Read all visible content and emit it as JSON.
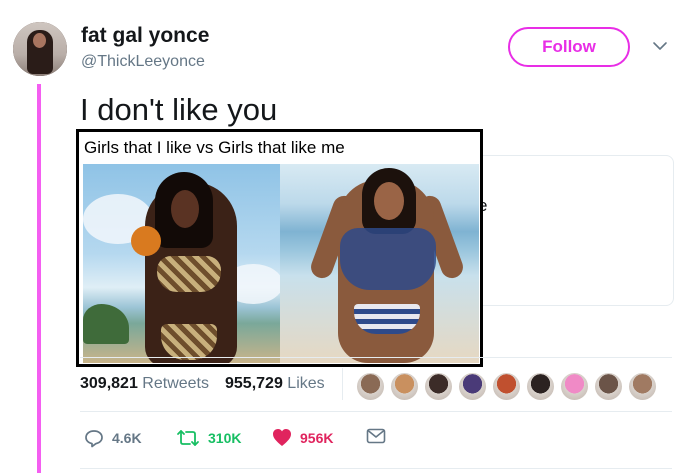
{
  "user": {
    "display_name": "fat gal yonce",
    "handle": "@ThickLeeyonce",
    "follow_label": "Follow"
  },
  "tweet": {
    "text": "I don't like you",
    "quoted_card_fragment": "e"
  },
  "meme": {
    "caption": "Girls that I like vs Girls  that like me"
  },
  "stats": {
    "retweets_count": "309,821",
    "retweets_label": "Retweets",
    "likes_count": "955,729",
    "likes_label": "Likes"
  },
  "liker_avatars": [
    {
      "name": "liker-1",
      "color": "#8a6a55"
    },
    {
      "name": "liker-2",
      "color": "#c9905f"
    },
    {
      "name": "liker-3",
      "color": "#3c2c28"
    },
    {
      "name": "liker-4",
      "color": "#4a3a78"
    },
    {
      "name": "liker-5",
      "color": "#c0502f"
    },
    {
      "name": "liker-6",
      "color": "#2b2221"
    },
    {
      "name": "liker-7",
      "color": "#f08ac6"
    },
    {
      "name": "liker-8",
      "color": "#6b5448"
    },
    {
      "name": "liker-9",
      "color": "#a07a62"
    }
  ],
  "actions": {
    "replies": "4.6K",
    "retweets": "310K",
    "likes": "956K"
  },
  "colors": {
    "accent_pink": "#e82ee6",
    "thread_line": "#f45ef1",
    "retweet_green": "#17bf63",
    "like_red": "#e0245e",
    "muted": "#657786"
  }
}
